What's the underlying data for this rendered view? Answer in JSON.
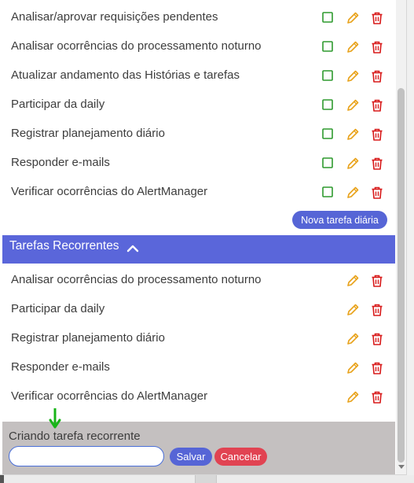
{
  "daily_tasks": [
    {
      "label": "Analisar/aprovar requisições pendentes"
    },
    {
      "label": "Analisar ocorrências do processamento noturno"
    },
    {
      "label": "Atualizar andamento das Histórias e tarefas"
    },
    {
      "label": "Participar da daily"
    },
    {
      "label": "Registrar planejamento diário"
    },
    {
      "label": "Responder e-mails"
    },
    {
      "label": "Verificar ocorrências do AlertManager"
    }
  ],
  "new_daily_button": "Nova tarefa diária",
  "recurring_section": {
    "title": "Tarefas Recorrentes",
    "tasks": [
      {
        "label": "Analisar ocorrências do processamento noturno"
      },
      {
        "label": "Participar da daily"
      },
      {
        "label": "Registrar planejamento diário"
      },
      {
        "label": "Responder e-mails"
      },
      {
        "label": "Verificar ocorrências do AlertManager"
      }
    ]
  },
  "create_form": {
    "label": "Criando tarefa recorrente",
    "input_value": "",
    "save_label": "Salvar",
    "cancel_label": "Cancelar"
  },
  "icons": {
    "complete": "checkbox-icon",
    "edit": "pencil-icon",
    "delete": "trash-icon",
    "collapse": "chevron-up-icon"
  },
  "colors": {
    "checkbox": "#2e9a2e",
    "edit": "#e8a21a",
    "delete": "#d81b1b",
    "primary": "#5a66da",
    "danger": "#e14352",
    "footer_bg": "#c4c0c0"
  }
}
